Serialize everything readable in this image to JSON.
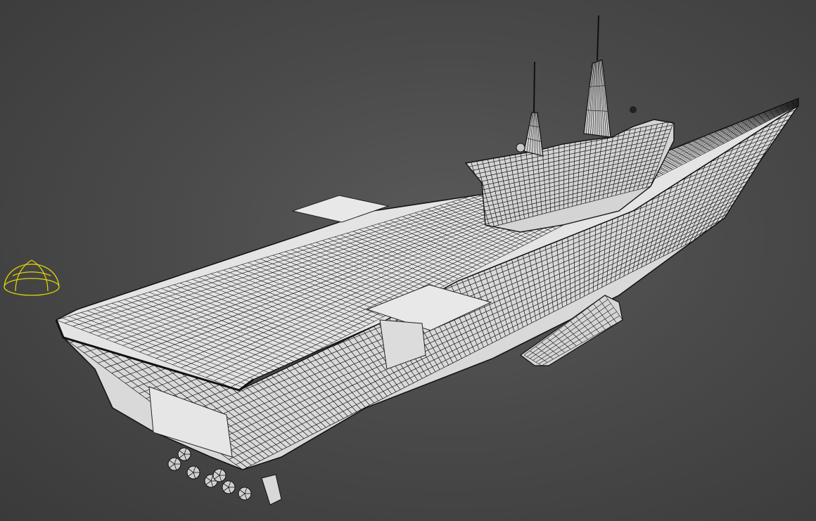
{
  "viewport": {
    "background": "#4b4b4b",
    "wire_color": "#111111",
    "surface_color": "#e2e2e2",
    "panel_color": "#d8d8d8",
    "helper_color": "#e0d400"
  },
  "objects": [
    {
      "name": "carrier-hull",
      "kind": "wireframe-mesh",
      "selected": false
    },
    {
      "name": "island-superstructure",
      "kind": "wireframe-mesh",
      "selected": false
    },
    {
      "name": "light-helper",
      "kind": "dome-gizmo",
      "selected": true
    }
  ]
}
